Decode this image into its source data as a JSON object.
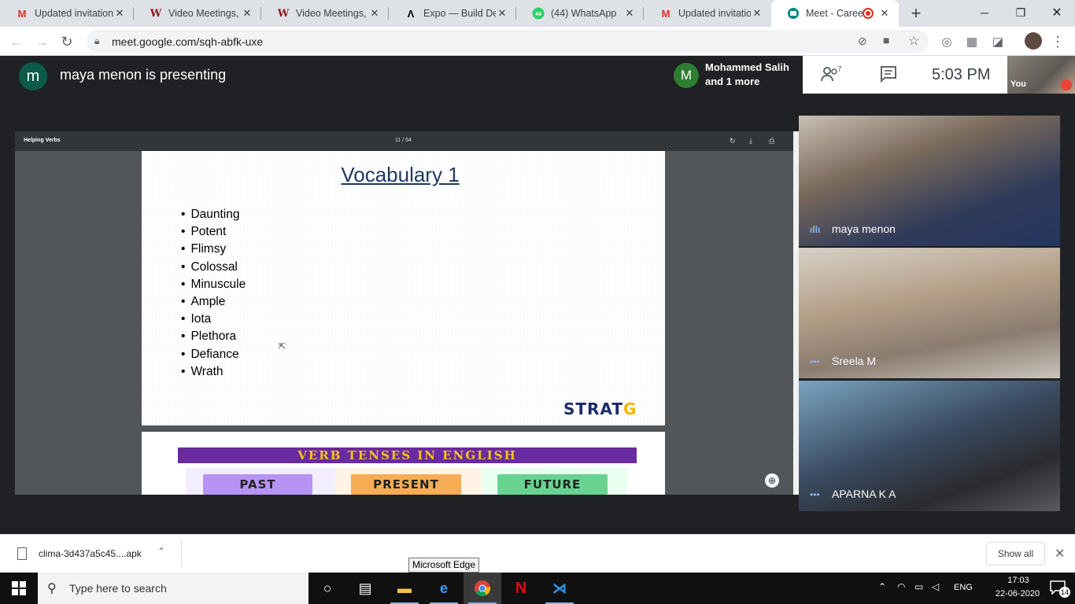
{
  "browser": {
    "tabs": [
      {
        "title": "Updated invitation",
        "icon": "gmail-icon",
        "color": "#d93025"
      },
      {
        "title": "Video Meetings, V",
        "icon": "wix-icon",
        "color": "#8b1a1a"
      },
      {
        "title": "Video Meetings, V",
        "icon": "wix-icon",
        "color": "#8b1a1a"
      },
      {
        "title": "Expo — Build Deta",
        "icon": "expo-icon",
        "color": "#000000"
      },
      {
        "title": "(44) WhatsApp",
        "icon": "whatsapp-icon",
        "color": "#25d366",
        "badge": "44"
      },
      {
        "title": "Updated invitation",
        "icon": "gmail-icon",
        "color": "#d93025"
      },
      {
        "title": "Meet - Caree",
        "icon": "meet-icon",
        "color": "#00897b",
        "active": true
      }
    ],
    "url": "meet.google.com/sqh-abfk-uxe"
  },
  "meet": {
    "presenter_initial": "m",
    "presenting_text": "maya menon is presenting",
    "others_initial": "M",
    "others_line1": "Mohammed Salih",
    "others_line2": "and 1 more",
    "people_count": "7",
    "clock": "5:03 PM",
    "self_label": "You",
    "participants": [
      {
        "name": "maya menon",
        "speaking": true
      },
      {
        "name": "Sreela M",
        "speaking": false
      },
      {
        "name": "APARNA K A",
        "speaking": false
      }
    ]
  },
  "pdf": {
    "title": "Helping Verbs",
    "page_indicator": "11 / 64",
    "slide_title": "Vocabulary 1",
    "vocabulary": [
      "Daunting",
      "Potent",
      "Flimsy",
      "Colossal",
      "Minuscule",
      "Ample",
      "Iota",
      "Plethora",
      "Defiance",
      "Wrath"
    ],
    "logo": "STRATG",
    "next_slide_banner": "VERB TENSES IN ENGLISH",
    "tenses": [
      {
        "label": "PAST",
        "color": "#b794f4",
        "bg": "#f0e8ff"
      },
      {
        "label": "PRESENT",
        "color": "#f6ad55",
        "bg": "#fff0e0"
      },
      {
        "label": "FUTURE",
        "color": "#68d391",
        "bg": "#e6ffed"
      }
    ]
  },
  "downloads": {
    "file_name": "clima-3d437a5c45....apk",
    "show_all": "Show all"
  },
  "tooltip": "Microsoft Edge",
  "taskbar": {
    "search_placeholder": "Type here to search",
    "language": "ENG",
    "time": "17:03",
    "date": "22-06-2020",
    "notifications": "14"
  }
}
